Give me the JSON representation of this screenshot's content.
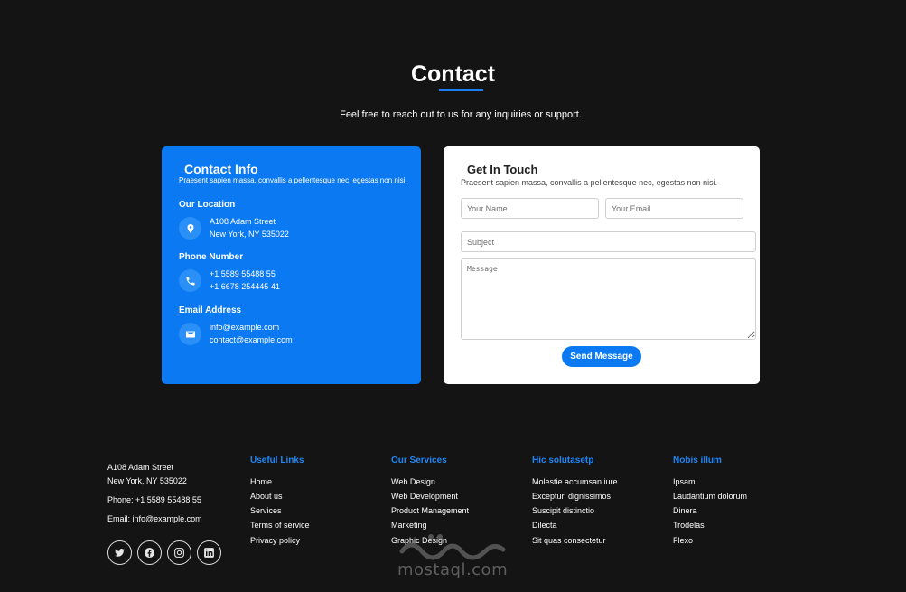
{
  "header": {
    "title": "Contact",
    "subtitle": "Feel free to reach out to us for any inquiries or support."
  },
  "contact_info": {
    "title": "Contact Info",
    "description": "Praesent sapien massa, convallis a pellentesque nec, egestas non nisi.",
    "location": {
      "label": "Our Location",
      "line1": "A108 Adam Street",
      "line2": "New York, NY 535022",
      "icon": "map-pin-icon"
    },
    "phone": {
      "label": "Phone Number",
      "line1": "+1 5589 55488 55",
      "line2": "+1 6678 254445 41",
      "icon": "phone-icon"
    },
    "email": {
      "label": "Email Address",
      "line1": "info@example.com",
      "line2": "contact@example.com",
      "icon": "envelope-icon"
    }
  },
  "form": {
    "title": "Get In Touch",
    "description": "Praesent sapien massa, convallis a pellentesque nec, egestas non nisi.",
    "name_placeholder": "Your Name",
    "email_placeholder": "Your Email",
    "subject_placeholder": "Subject",
    "message_placeholder": "Message",
    "name_value": "",
    "email_value": "",
    "subject_value": "",
    "message_value": "",
    "submit_label": "Send Message"
  },
  "footer": {
    "address_line1": "A108 Adam Street",
    "address_line2": "New York, NY 535022",
    "phone": "Phone: +1 5589 55488 55",
    "email": "Email: info@example.com",
    "social_icons": [
      "twitter-icon",
      "facebook-icon",
      "instagram-icon",
      "linkedin-icon"
    ],
    "columns": [
      {
        "heading": "Useful Links",
        "links": [
          "Home",
          "About us",
          "Services",
          "Terms of service",
          "Privacy policy"
        ]
      },
      {
        "heading": "Our Services",
        "links": [
          "Web Design",
          "Web Development",
          "Product Management",
          "Marketing",
          "Graphic Design"
        ]
      },
      {
        "heading": "Hic solutasetp",
        "links": [
          "Molestie accumsan iure",
          "Excepturi dignissimos",
          "Suscipit distinctio",
          "Dilecta",
          "Sit quas consectetur"
        ]
      },
      {
        "heading": "Nobis illum",
        "links": [
          "Ipsam",
          "Laudantium dolorum",
          "Dinera",
          "Trodelas",
          "Flexo"
        ]
      }
    ]
  },
  "watermark": {
    "text": "mostaql.com"
  },
  "colors": {
    "background": "#141414",
    "accent": "#0a79f2",
    "footer_heading": "#1e86f5",
    "card": "#ffffff"
  }
}
